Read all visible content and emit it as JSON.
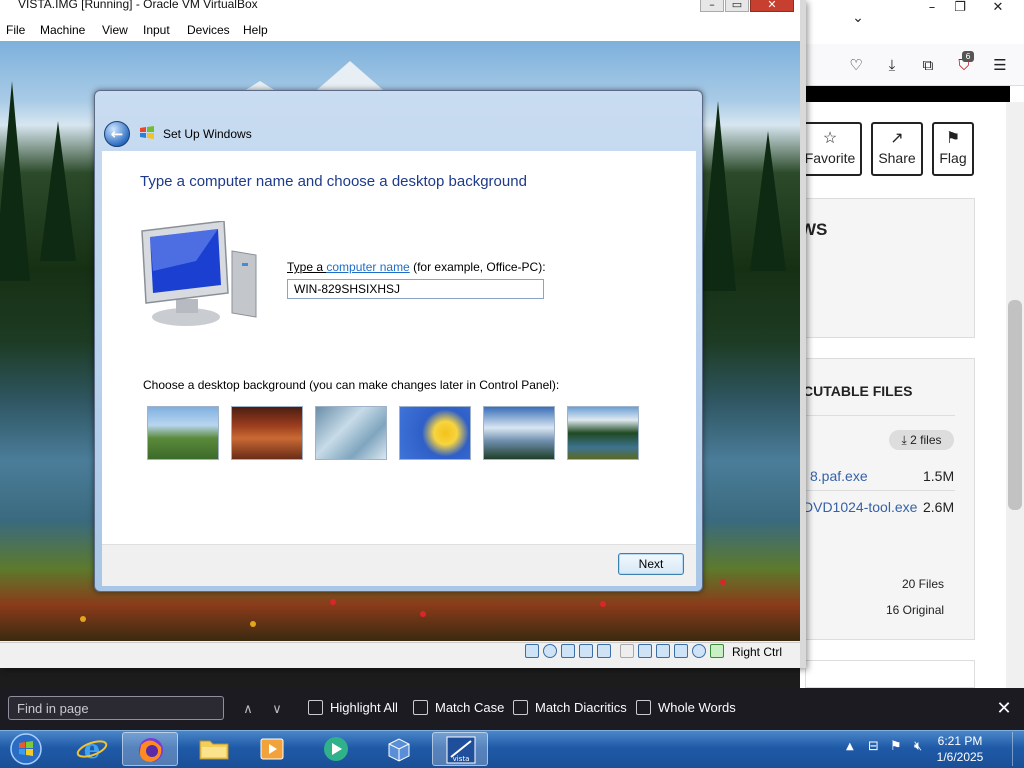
{
  "vbox": {
    "title": "VISTA.IMG [Running] - Oracle VM VirtualBox",
    "menu": [
      "File",
      "Machine",
      "View",
      "Input",
      "Devices",
      "Help"
    ],
    "status_right": "Right Ctrl"
  },
  "dialog": {
    "title": "Set Up Windows",
    "heading": "Type a computer name and choose a desktop background",
    "name_label_prefix": "Type a ",
    "name_label_link": "computer name",
    "name_label_suffix": " (for example, Office-PC):",
    "computer_name": "WIN-829SHSIXHSJ",
    "bg_label": "Choose a desktop background (you can make changes later in Control Panel):",
    "next_label": "Next"
  },
  "firefox": {
    "notif_count": "6",
    "buttons": [
      "Favorite",
      "Share",
      "Flag"
    ],
    "heading_partial": "WS",
    "section_title_partial": "CUTABLE FILES",
    "files_pill": "2 files",
    "files": [
      {
        "name": "8.paf.exe",
        "size": "1.5M"
      },
      {
        "name": "DVD1024-tool.exe",
        "size": "2.6M"
      }
    ],
    "stats": [
      "20 Files",
      "16 Original"
    ]
  },
  "findbar": {
    "placeholder": "Find in page",
    "options": [
      "Highlight All",
      "Match Case",
      "Match Diacritics",
      "Whole Words"
    ]
  },
  "taskbar": {
    "time": "6:21 PM",
    "date": "1/6/2025"
  },
  "colors": {
    "dialog_heading": "#1e3a8a",
    "link": "#1e6ec8",
    "taskbar": "#1f5aa8"
  }
}
